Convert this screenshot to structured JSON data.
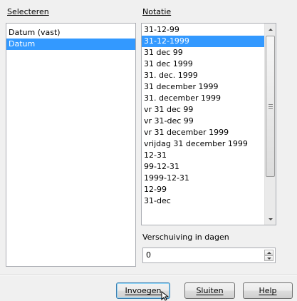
{
  "select": {
    "label": "Selecteren",
    "items": [
      {
        "label": "Datum (vast)",
        "selected": false
      },
      {
        "label": "Datum",
        "selected": true
      }
    ]
  },
  "notation": {
    "label": "Notatie",
    "items": [
      {
        "label": "31-12-99",
        "selected": false
      },
      {
        "label": "31-12-1999",
        "selected": true
      },
      {
        "label": "31 dec 99",
        "selected": false
      },
      {
        "label": "31 dec 1999",
        "selected": false
      },
      {
        "label": "31. dec. 1999",
        "selected": false
      },
      {
        "label": "31 december 1999",
        "selected": false
      },
      {
        "label": "31. december 1999",
        "selected": false
      },
      {
        "label": "vr 31 dec 99",
        "selected": false
      },
      {
        "label": "vr 31-dec 99",
        "selected": false
      },
      {
        "label": "vr 31 december 1999",
        "selected": false
      },
      {
        "label": "vrijdag 31 december 1999",
        "selected": false
      },
      {
        "label": "12-31",
        "selected": false
      },
      {
        "label": "99-12-31",
        "selected": false
      },
      {
        "label": "1999-12-31",
        "selected": false
      },
      {
        "label": "12-99",
        "selected": false
      },
      {
        "label": "31-dec",
        "selected": false
      }
    ]
  },
  "offset": {
    "label": "Verschuiving in dagen",
    "value": "0"
  },
  "buttons": {
    "insert": "Invoegen",
    "close": "Sluiten",
    "help": "Help"
  },
  "icons": {
    "scroll_up": "chevron-up-icon",
    "scroll_down": "chevron-down-icon",
    "spin_up": "spin-up-icon",
    "spin_down": "spin-down-icon",
    "cursor": "mouse-pointer-icon"
  }
}
